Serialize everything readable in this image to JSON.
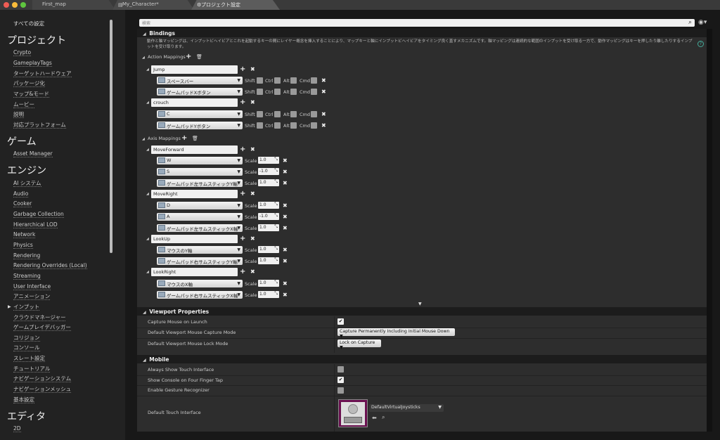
{
  "tabs": [
    {
      "label": "First_map"
    },
    {
      "label": "My_Character*"
    },
    {
      "label": "プロジェクト設定"
    }
  ],
  "sidebar": {
    "all": "すべての設定",
    "groups": [
      {
        "title": "プロジェクト",
        "items": [
          "Crypto",
          "GameplayTags",
          "ターゲットハードウェア",
          "パッケージ化",
          "マップ&モード",
          "ムービー",
          "説明",
          "対応プラットフォーム"
        ]
      },
      {
        "title": "ゲーム",
        "items": [
          "Asset Manager"
        ]
      },
      {
        "title": "エンジン",
        "items": [
          "AI システム",
          "Audio",
          "Cooker",
          "Garbage Collection",
          "Hierarchical LOD",
          "Network",
          "Physics",
          "Rendering",
          "Rendering Overrides (Local)",
          "Streaming",
          "User Interface",
          "アニメーション",
          "インプット",
          "クラウドマネージャー",
          "ゲームプレイデバッガー",
          "コリジョン",
          "コンソール",
          "スレート設定",
          "チュートリアル",
          "ナビゲーションシステム",
          "ナビゲーションメッシュ",
          "基本設定"
        ]
      },
      {
        "title": "エディタ",
        "items": [
          "2D"
        ]
      }
    ]
  },
  "search": {
    "placeholder": "検索"
  },
  "bindings": {
    "title": "Bindings",
    "description": "動作と軸マッピングは、インプットビヘイビアとこれを起動するキーの間にレイヤー概念を挿入することにより、マップキーと軸にインプットビヘイビアをタイミング良く直すメカニズムです。軸マッピングは連続的な範囲のインプットを受け取る一方で、動作マッピングはキーを押したり離したりするインプットを受け取ります。",
    "action_label": "Action Mappings",
    "axis_label": "Axis Mappings",
    "mod_shift": "Shift",
    "mod_ctrl": "Ctrl",
    "mod_alt": "Alt",
    "mod_cmd": "Cmd",
    "scale_label": "Scale",
    "actions": [
      {
        "name": "Jump",
        "keys": [
          "スペースバー",
          "ゲームパッドXボタン"
        ]
      },
      {
        "name": "crouch",
        "keys": [
          "C",
          "ゲームパッドYボタン"
        ]
      }
    ],
    "axes": [
      {
        "name": "MoveForward",
        "keys": [
          {
            "key": "W",
            "scale": "1.0"
          },
          {
            "key": "S",
            "scale": "-1.0"
          },
          {
            "key": "ゲームパッド左サムスティックY軸",
            "scale": "1.0"
          }
        ]
      },
      {
        "name": "MoveRight",
        "keys": [
          {
            "key": "D",
            "scale": "1.0"
          },
          {
            "key": "A",
            "scale": "-1.0"
          },
          {
            "key": "ゲームパッド左サムスティックX軸",
            "scale": "1.0"
          }
        ]
      },
      {
        "name": "LookUp",
        "keys": [
          {
            "key": "マウスのY軸",
            "scale": "1.0"
          },
          {
            "key": "ゲームパッド右サムスティックY軸",
            "scale": "1.0"
          }
        ]
      },
      {
        "name": "LookRight",
        "keys": [
          {
            "key": "マウスのX軸",
            "scale": "1.0"
          },
          {
            "key": "ゲームパッド右サムスティックX軸",
            "scale": "1.0"
          }
        ]
      }
    ]
  },
  "viewport": {
    "title": "Viewport Properties",
    "capture_launch": "Capture Mouse on Launch",
    "capture_mode": "Default Viewport Mouse Capture Mode",
    "capture_mode_value": "Capture Permanently Including Initial Mouse Down",
    "lock_mode": "Default Viewport Mouse Lock Mode",
    "lock_mode_value": "Lock on Capture"
  },
  "mobile": {
    "title": "Mobile",
    "always_touch": "Always Show Touch Interface",
    "show_console": "Show Console on Four Finger Tap",
    "gesture": "Enable Gesture Recognizer",
    "touch_interface": "Default Touch Interface",
    "touch_value": "DefaultVirtualJoysticks"
  }
}
